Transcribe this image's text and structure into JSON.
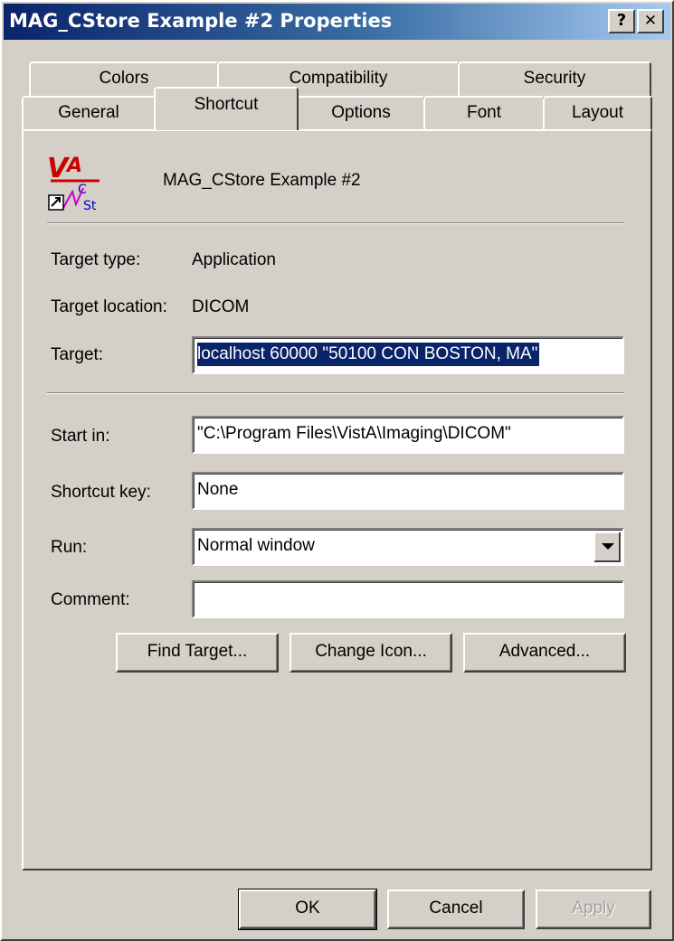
{
  "window": {
    "title": "MAG_CStore Example #2 Properties",
    "help_button": "?",
    "close_button": "✕"
  },
  "tabs": {
    "row1": [
      "Colors",
      "Compatibility",
      "Security"
    ],
    "row2": [
      "General",
      "Shortcut",
      "Options",
      "Font",
      "Layout"
    ],
    "active": "Shortcut"
  },
  "shortcut": {
    "name": "MAG_CStore Example #2",
    "icon": "vista-cstore-shortcut-icon",
    "target_type_label": "Target type:",
    "target_type_value": "Application",
    "target_location_label": "Target location:",
    "target_location_value": "DICOM",
    "target_label": "Target:",
    "target_value": "localhost 60000 \"50100  CON     BOSTON, MA\"",
    "start_in_label": "Start in:",
    "start_in_value": "\"C:\\Program Files\\VistA\\Imaging\\DICOM\"",
    "shortcut_key_label": "Shortcut key:",
    "shortcut_key_value": "None",
    "run_label": "Run:",
    "run_value": "Normal window",
    "comment_label": "Comment:",
    "comment_value": "",
    "find_target_button": "Find Target...",
    "change_icon_button": "Change Icon...",
    "advanced_button": "Advanced..."
  },
  "footer": {
    "ok_button": "OK",
    "cancel_button": "Cancel",
    "apply_button": "Apply"
  },
  "colors": {
    "title_start": "#0a246a",
    "title_end": "#a6caf0",
    "face": "#d4d0c8",
    "selection": "#0a246a"
  }
}
